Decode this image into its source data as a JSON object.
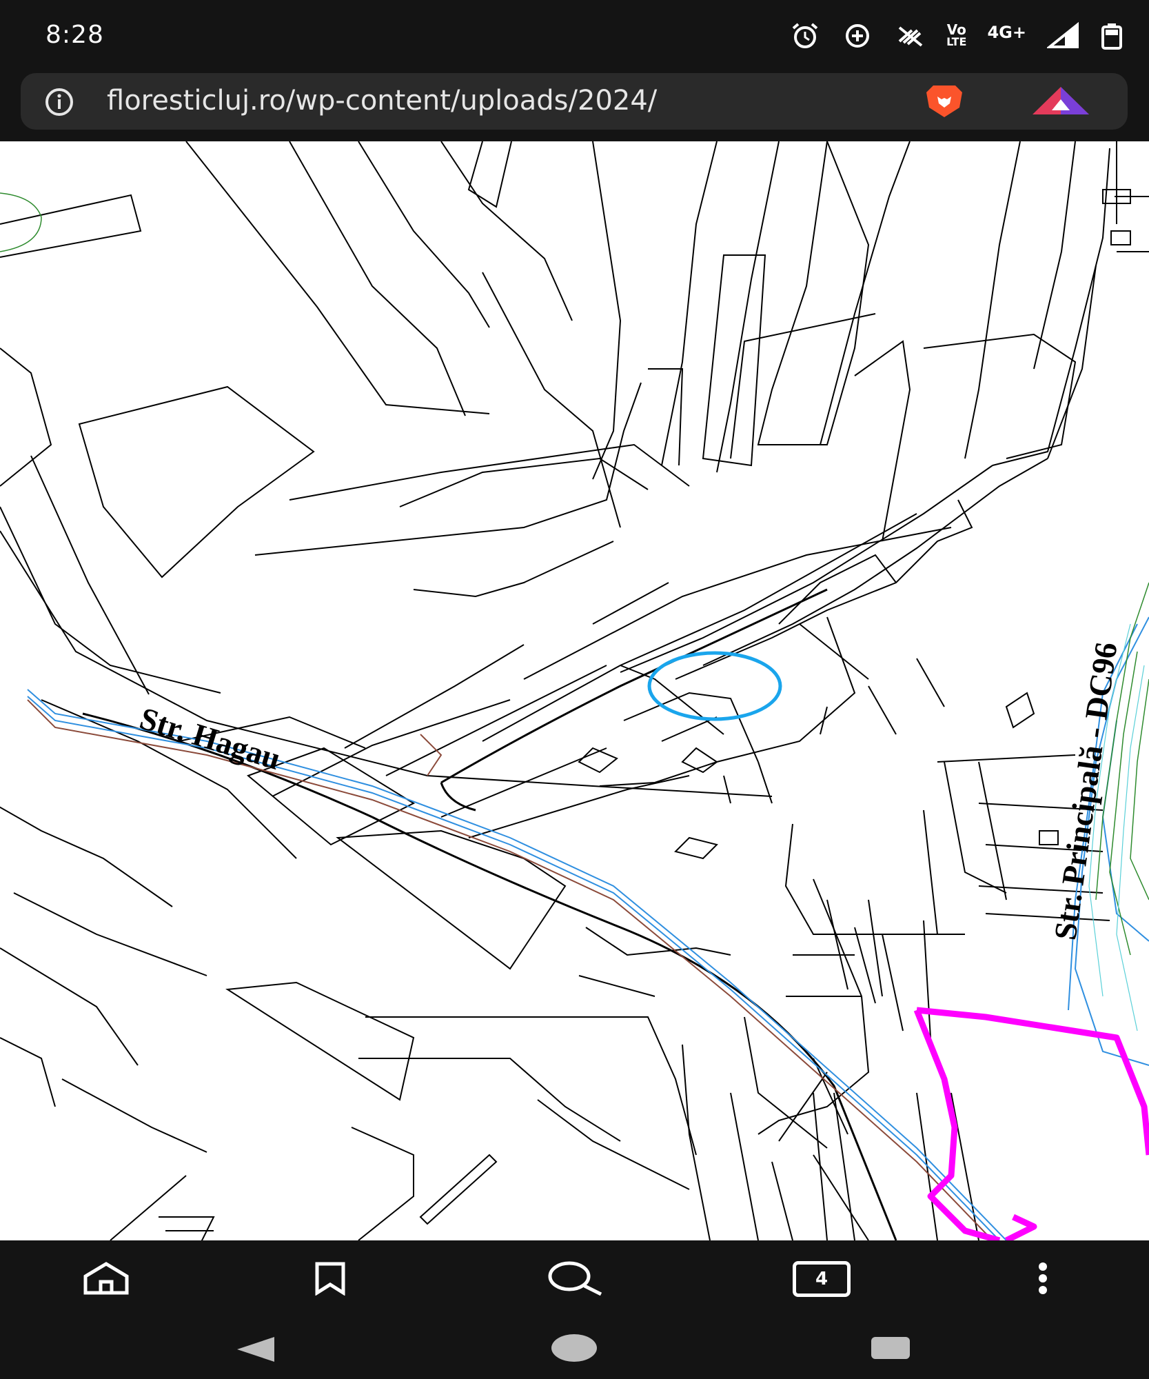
{
  "status_bar": {
    "time": "8:28",
    "icons": [
      "alarm-icon",
      "data-saver-icon",
      "vibrate-off-icon",
      "volte-icon",
      "4g-plus-icon",
      "signal-icon",
      "battery-icon"
    ],
    "network_labels": {
      "volte_top": "Vo",
      "volte_bottom": "LTE",
      "mobile_data": "4G+"
    }
  },
  "address_bar": {
    "url": "floresticluj.ro/wp-content/uploads/2024/",
    "icons": [
      "info-icon",
      "brave-shields-icon",
      "brave-rewards-icon"
    ]
  },
  "map": {
    "street_labels": {
      "hagau": "Str. Hagau",
      "principala": "Str. Principală - DC96"
    },
    "colors": {
      "parcel_lines": "#000000",
      "blue_line": "#2f8fe0",
      "brown_line": "#8b4a3a",
      "magenta_boundary": "#ff00ff",
      "highlight_circle": "#1aa5ec",
      "green_contour": "#2e8b2e"
    }
  },
  "bottom_toolbar": {
    "items": [
      "home-icon",
      "bookmark-icon",
      "search-icon",
      "tabs-icon",
      "menu-icon"
    ],
    "tab_count": "4"
  },
  "system_nav": {
    "items": [
      "back-icon",
      "home-pill-icon",
      "recents-icon"
    ]
  }
}
